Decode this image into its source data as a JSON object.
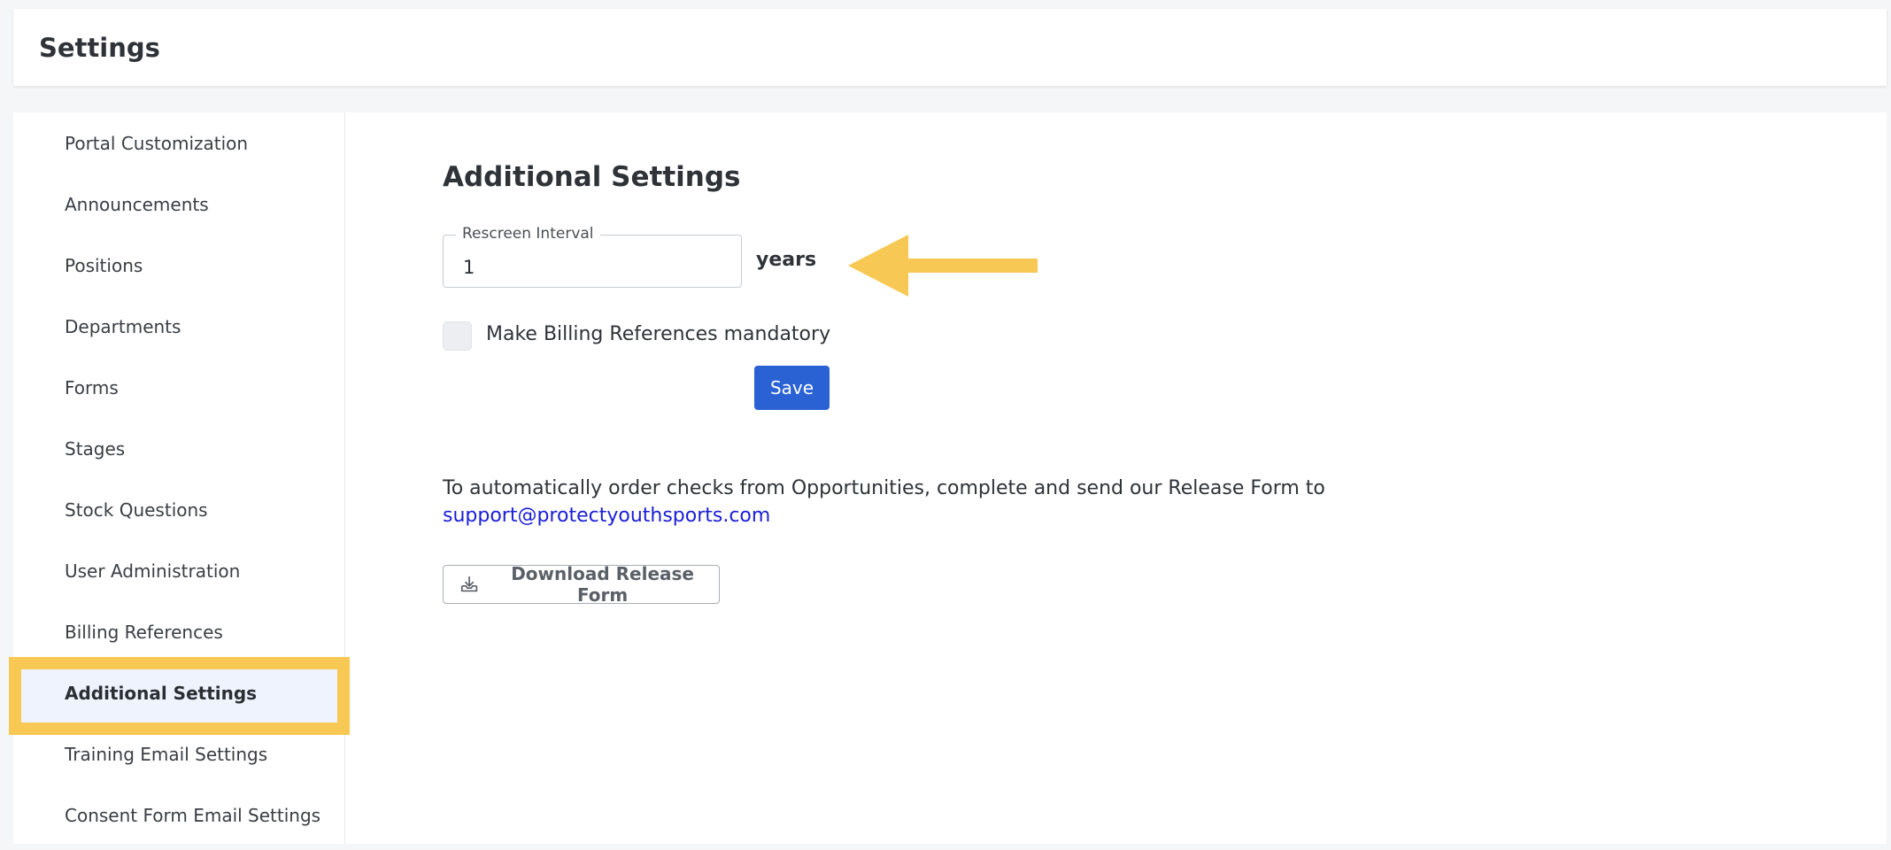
{
  "header": {
    "title": "Settings"
  },
  "sidebar": {
    "items": [
      {
        "label": "Portal Customization"
      },
      {
        "label": "Announcements"
      },
      {
        "label": "Positions"
      },
      {
        "label": "Departments"
      },
      {
        "label": "Forms"
      },
      {
        "label": "Stages"
      },
      {
        "label": "Stock Questions"
      },
      {
        "label": "User Administration"
      },
      {
        "label": "Billing References"
      },
      {
        "label": "Additional Settings",
        "active": true
      },
      {
        "label": "Training Email Settings"
      },
      {
        "label": "Consent Form Email Settings"
      }
    ]
  },
  "main": {
    "title": "Additional Settings",
    "rescreen": {
      "label": "Rescreen Interval",
      "value": "1",
      "unit": "years"
    },
    "billing_checkbox": {
      "label": "Make Billing References mandatory",
      "checked": false
    },
    "save_label": "Save",
    "info_text": "To automatically order checks from Opportunities, complete and send our Release Form to",
    "info_link": "support@protectyouthsports.com",
    "download_label": "Download Release Form"
  },
  "colors": {
    "accent": "#2a62d4",
    "link": "#1a1ed6",
    "annotation": "#f7c954",
    "active_bg": "#eef3fd"
  },
  "icons": {
    "download": "download-tray-icon",
    "annotation_arrow": "arrow-left-icon"
  }
}
